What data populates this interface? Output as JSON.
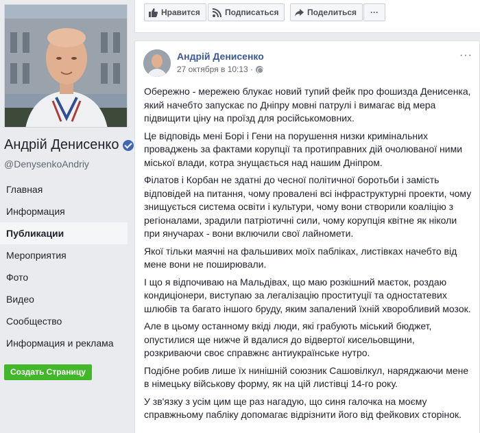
{
  "page": {
    "name": "Андрій Денисенко",
    "username": "@DenysenkoAndriy"
  },
  "nav": {
    "items": [
      {
        "label": "Главная"
      },
      {
        "label": "Информация"
      },
      {
        "label": "Публикации",
        "active": true
      },
      {
        "label": "Мероприятия"
      },
      {
        "label": "Фото"
      },
      {
        "label": "Видео"
      },
      {
        "label": "Сообщество"
      },
      {
        "label": "Информация и реклама"
      }
    ],
    "create_page_label": "Создать Страницу"
  },
  "actionbar": {
    "like_label": "Нравится",
    "subscribe_label": "Подписаться",
    "share_label": "Поделиться",
    "more_label": "···"
  },
  "post": {
    "author": "Андрій Денисенко",
    "timestamp": "27 октября в 10:13 ·",
    "menu_label": "···",
    "paragraphs": [
      "Обережно - мережею блукає новий тупий фейк про фошизда Денисенка, який начебто запускає по Дніпру мовні патрулі і вимагає від мера підвищити ціну на проїзд для російськомовних.",
      "Це відповідь мені Борі і Гени на порушення низки кримінальних проваджень за фактами корупції та протиправних дій очолюваної ними міської влади, котра знущається над нашим Дніпром.",
      "Філатов і Корбан не здатні до чесної політичної боротьби і замість відповідей на питання, чому провалені всі інфраструктурні проекти, чому знищується система освіти і культури, чому вони створили коаліцію з регіоналами, зрадили патріотичні сили, чому корупція квітне як ніколи при януча­рах - вони включили свої лайномети.",
      "Якої тільки маячні на фальшивих моїх пабліках, листівках начебто від мене вони не поширювали.",
      "І що я відпочиваю на Мальдівах, що маю розкішний маєток, роздаю кондиціонери, виступаю за легалізацію проституції та одностатевих шлюбів та багато іншого бруду, яким запалений їхній хворобливий мозок.",
      "Але в цьому останному вкіді люди, які грабують міський бюджет, опустилися ще нижче й вдалися до відвертої кисельовщини, розкриваючи своє справжнє антиукраїнське нутро.",
      "Подібне робив лише їх нинішній союзник Сашовілкул, наряджаючи мене в німецьку військову форму, як на цій листівці 14-го року.",
      "У зв'язку з усім цим ще раз нагадую, що синя галочка на моєму справжньому паблiку допомагає відрізнити його від фейкових сторінок."
    ]
  },
  "colors": {
    "link": "#385898",
    "green": "#42b72a",
    "verified": "#4267b2",
    "background": "#e9ebee"
  }
}
